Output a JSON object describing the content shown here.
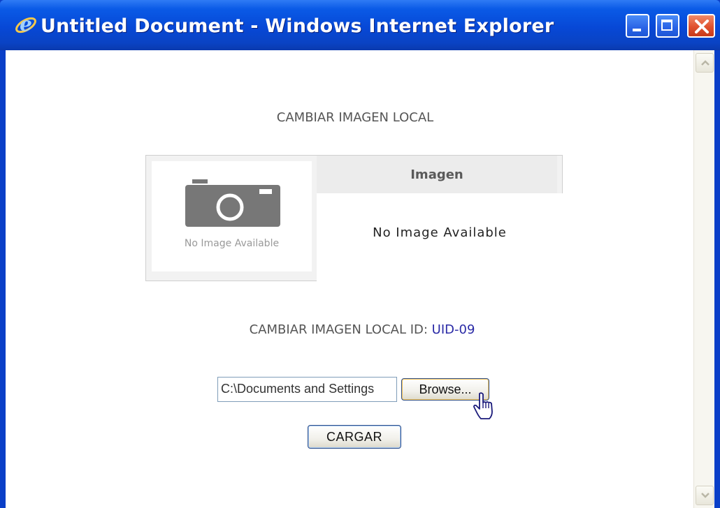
{
  "window": {
    "title": "Untitled Document - Windows Internet Explorer",
    "app_icon": "internet-explorer-icon"
  },
  "page": {
    "heading": "CAMBIAR IMAGEN LOCAL",
    "photo_caption": "No Image Available",
    "column_header": "Imagen",
    "column_body": "No Image Available",
    "id_label": "CAMBIAR IMAGEN LOCAL ID:",
    "id_value": "UID-09",
    "file_path": "C:\\Documents and Settings",
    "browse_label": "Browse...",
    "submit_label": "CARGAR"
  },
  "colors": {
    "titlebar": "#0a4fd6",
    "id_value": "#2a2aa6"
  }
}
